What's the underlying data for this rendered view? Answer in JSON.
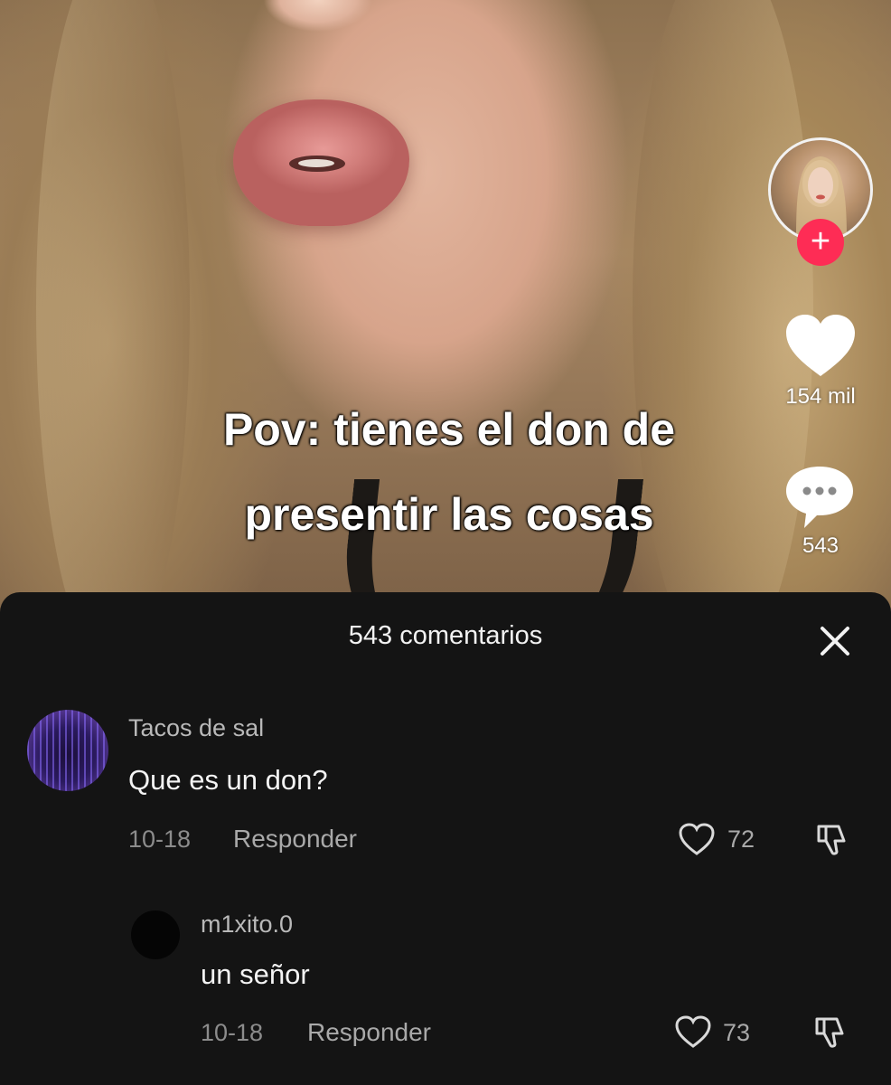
{
  "video": {
    "caption_line1": "Pov: tienes el don de",
    "caption_line2": "presentir las cosas"
  },
  "side_rail": {
    "follow_symbol": "+",
    "like_icon": "heart-icon",
    "like_count": "154 mil",
    "comment_icon": "comment-bubble-icon",
    "comment_count": "543",
    "follow_color": "#fe2c55"
  },
  "comments_sheet": {
    "title": "543 comentarios",
    "close_icon": "close-icon",
    "comments": [
      {
        "username": "Tacos de sal",
        "text": "Que es un don?",
        "date": "10-18",
        "reply_label": "Responder",
        "like_count": "72"
      },
      {
        "username": "m1xito.0",
        "text": "un señor",
        "date": "10-18",
        "reply_label": "Responder",
        "like_count": "73"
      }
    ]
  }
}
